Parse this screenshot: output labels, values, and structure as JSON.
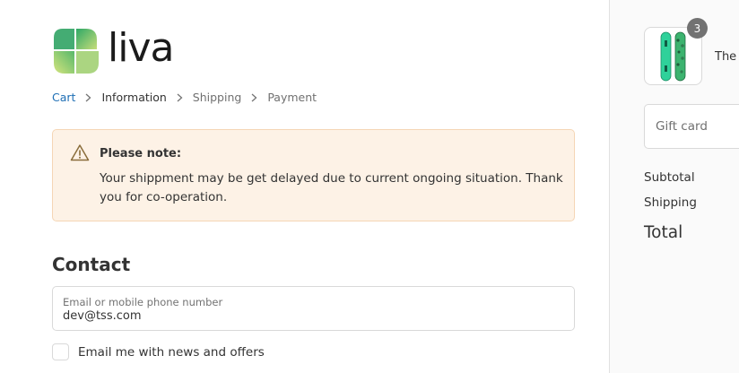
{
  "brand": {
    "name": "liva"
  },
  "breadcrumb": [
    {
      "label": "Cart"
    },
    {
      "label": "Information"
    },
    {
      "label": "Shipping"
    },
    {
      "label": "Payment"
    }
  ],
  "notice": {
    "title": "Please note:",
    "body": "Your shippment may be get delayed due to current ongoing situation. Thank you for co-operation."
  },
  "contact": {
    "heading": "Contact",
    "email_label": "Email or mobile phone number",
    "email_value": "dev@tss.com",
    "newsletter_label": "Email me with news and offers",
    "newsletter_checked": false
  },
  "order_summary": {
    "item": {
      "quantity": "3",
      "name_visible": "The I",
      "thumb_icon": "snowboard-icon"
    },
    "gift_card_placeholder": "Gift card",
    "subtotal_label": "Subtotal",
    "shipping_label": "Shipping",
    "total_label": "Total"
  },
  "colors": {
    "link": "#1f6fb5",
    "notice_bg": "#fdf2e6",
    "notice_border": "#f5d6b5",
    "brand_green": "#3fae6a",
    "sidebar_bg": "#fafafa"
  }
}
